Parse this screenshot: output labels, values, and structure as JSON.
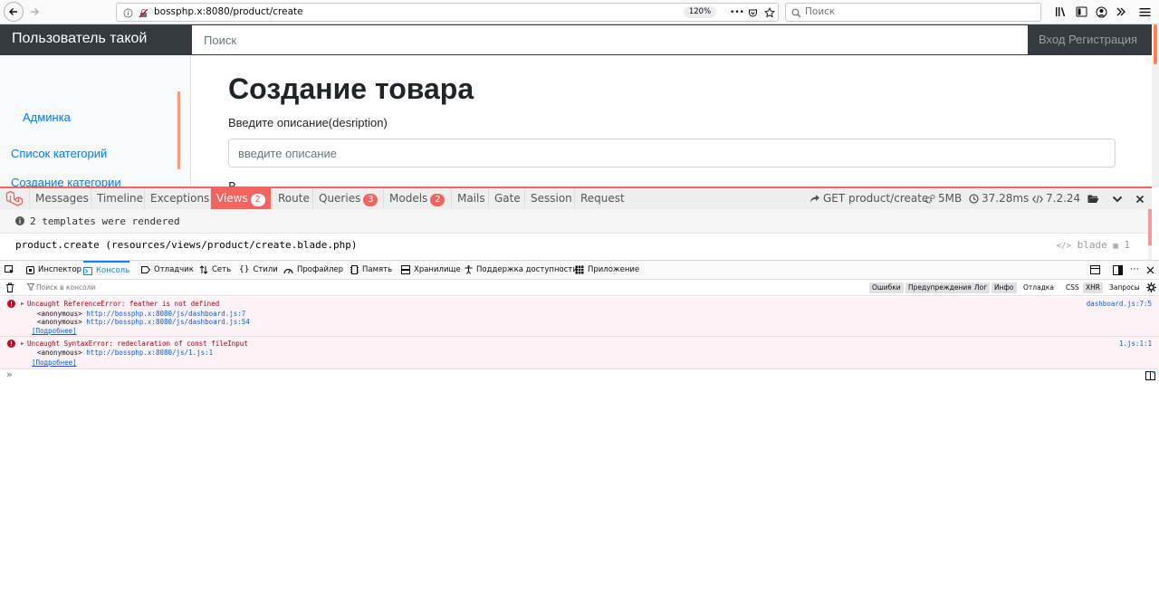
{
  "browser": {
    "url": "bossphp.x:8080/product/create",
    "zoom": "120%",
    "more": "•••",
    "search_placeholder": "Поиск"
  },
  "site": {
    "brand": "Пользователь такой",
    "search_placeholder": "Поиск",
    "auth_links": "Вход Регистрация"
  },
  "sidebar": {
    "items": [
      "Админка",
      "Список категорий",
      "Создание категории"
    ]
  },
  "main": {
    "title": "Создание товара",
    "description_label": "Введите описание(desription)",
    "description_placeholder": "введите описание",
    "next_label_clip": "В"
  },
  "debugbar": {
    "tabs": [
      {
        "label": "Messages"
      },
      {
        "label": "Timeline"
      },
      {
        "label": "Exceptions"
      },
      {
        "label": "Views",
        "badge": "2"
      },
      {
        "label": "Route"
      },
      {
        "label": "Queries",
        "badge": "3"
      },
      {
        "label": "Models",
        "badge": "2"
      },
      {
        "label": "Mails"
      },
      {
        "label": "Gate"
      },
      {
        "label": "Session"
      },
      {
        "label": "Request"
      }
    ],
    "request": "GET product/create",
    "memory": "5MB",
    "time": "37.28ms",
    "php_version": "7.2.24",
    "summary": "2 templates were rendered",
    "template_row": "product.create (resources/views/product/create.blade.php)",
    "template_type": "blade",
    "template_params": "1"
  },
  "devtools": {
    "tabs": [
      "Инспектор",
      "Консоль",
      "Отладчик",
      "Сеть",
      "Стили",
      "Профайлер",
      "Память",
      "Хранилище",
      "Поддержка доступности",
      "Приложение"
    ],
    "filter_placeholder": "Поиск в консоли",
    "filters": [
      "Ошибки",
      "Предупреждения",
      "Лог",
      "Инфо",
      "Отладка",
      "CSS",
      "XHR",
      "Запросы"
    ],
    "errors": [
      {
        "message": "Uncaught ReferenceError: feather is not defined",
        "trace": [
          {
            "fn": "<anonymous>",
            "url": "http://bossphp.x:8080/js/dashboard.js:7"
          },
          {
            "fn": "<anonymous>",
            "url": "http://bossphp.x:8080/js/dashboard.js:54"
          }
        ],
        "more": "[Подробнее]",
        "source": "dashboard.js:7:5"
      },
      {
        "message": "Uncaught SyntaxError: redeclaration of const fileInput",
        "trace": [
          {
            "fn": "<anonymous>",
            "url": "http://bossphp.x:8080/js/1.js:1"
          }
        ],
        "more": "[Подробнее]",
        "source": "1.js:1:1"
      }
    ],
    "prompt": "»"
  },
  "colors": {
    "navbar_bg": "#343a40",
    "link": "#007bff",
    "debugbar_accent": "#f4645f",
    "devtools_accent": "#0a84ff",
    "error_text": "#a4000f"
  }
}
